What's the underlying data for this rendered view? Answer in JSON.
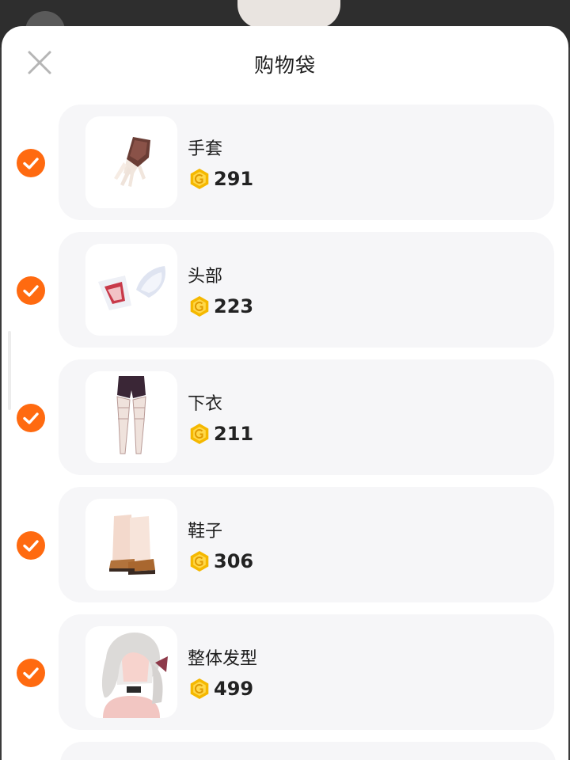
{
  "title": "购物袋",
  "accent_color": "#ff6a10",
  "coin_color": "#f5b800",
  "icons": {
    "close": "close-icon",
    "check": "check-icon",
    "coin": "coin-icon"
  },
  "cart": {
    "items": [
      {
        "name": "手套",
        "price": "291",
        "thumbnail": "gloves-icon",
        "selected": true
      },
      {
        "name": "头部",
        "price": "223",
        "thumbnail": "cat-ears-icon",
        "selected": true
      },
      {
        "name": "下衣",
        "price": "211",
        "thumbnail": "stockings-icon",
        "selected": true
      },
      {
        "name": "鞋子",
        "price": "306",
        "thumbnail": "boots-icon",
        "selected": true
      },
      {
        "name": "整体发型",
        "price": "499",
        "thumbnail": "hairstyle-icon",
        "selected": true
      }
    ]
  }
}
